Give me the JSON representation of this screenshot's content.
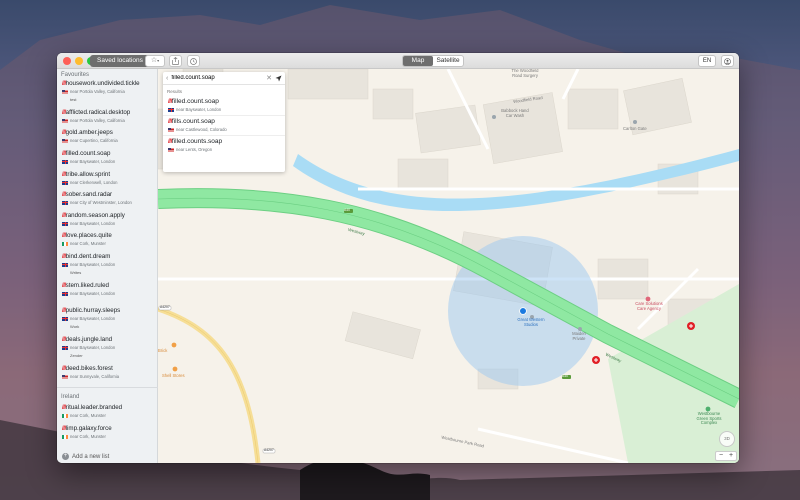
{
  "toolbar": {
    "saved_locations_label": "Saved locations",
    "view_modes": [
      {
        "label": "Map",
        "active": true
      },
      {
        "label": "Satellite",
        "active": false
      }
    ],
    "language_label": "EN"
  },
  "sidebar": {
    "sections": [
      {
        "title": "Favourites",
        "items": [
          {
            "address": "housework.undivided.tickle",
            "near": "near Portola Valley, California",
            "flag": "us",
            "note": "test"
          },
          {
            "address": "afflicted.radical.desktop",
            "near": "near Portola Valley, California",
            "flag": "us"
          },
          {
            "address": "gold.amber.jeeps",
            "near": "near Cupertino, California",
            "flag": "us"
          },
          {
            "address": "filled.count.soap",
            "near": "near Bayswater, London",
            "flag": "gb"
          },
          {
            "address": "tribe.allow.sprint",
            "near": "near Clerkenwell, London",
            "flag": "gb"
          },
          {
            "address": "sober.sand.radar",
            "near": "near City of Westminster, London",
            "flag": "gb"
          },
          {
            "address": "random.season.apply",
            "near": "near Bayswater, London",
            "flag": "gb"
          },
          {
            "address": "love.places.quite",
            "near": "near Cork, Munster",
            "flag": "ie"
          },
          {
            "address": "bind.dent.dream",
            "near": "near Bayswater, London",
            "flag": "gb",
            "note": "Writes"
          },
          {
            "address": "stem.liked.ruled",
            "near": "near Bayswater, London",
            "flag": "gb"
          },
          {
            "address": "public.hurray.sleeps",
            "near": "near Bayswater, London",
            "flag": "gb",
            "note": "Work"
          },
          {
            "address": "deals.jungle.land",
            "near": "near Bayswater, London",
            "flag": "gb",
            "note": "Zender"
          },
          {
            "address": "deed.bikes.forest",
            "near": "near Sunnyvale, California",
            "flag": "us"
          }
        ]
      },
      {
        "title": "Ireland",
        "items": [
          {
            "address": "ritual.leader.branded",
            "near": "near Cork, Munster",
            "flag": "ie"
          },
          {
            "address": "limp.galaxy.force",
            "near": "near Cork, Munster",
            "flag": "ie"
          }
        ]
      }
    ],
    "add_list_label": "Add a new list"
  },
  "search": {
    "value": "filled.count.soap",
    "results_label": "Results",
    "results": [
      {
        "address": "filled.count.soap",
        "near": "near Bayswater, London",
        "flag": "gb"
      },
      {
        "address": "fills.count.soap",
        "near": "near Castlewood, Colorado",
        "flag": "us"
      },
      {
        "address": "filled.counts.soap",
        "near": "near Lents, Oregon",
        "flag": "us"
      }
    ]
  },
  "map": {
    "labels": {
      "westway_1": "Westway",
      "westway_2": "Westway",
      "road_a40_1": "A40",
      "road_a40_2": "A40",
      "road_a4207": "A4207",
      "road_a4207_b": "A4207",
      "westbourne_park_road": "Westbourne Park Road",
      "woodfield_road": "Woodfield Road",
      "babbock_car_wash": "Babbock Hand Car Wash",
      "carlton_gate": "Carlton Gate",
      "surgery": "The Woodfield Road Surgery",
      "great_western_studios": "Great Western Studios",
      "maiden_lane": "Maiden Private",
      "care_agency": "Care Solutions Care Agency",
      "westbourne_green": "Westbourne Green Sports Complex",
      "shell": "Shell Stores",
      "brick": "Brick",
      "compass": "3D"
    }
  },
  "colors": {
    "accent_red": "#e11f26",
    "motorway_green": "#8fe8a2",
    "water_blue": "#a9dcf5",
    "location_blue": "#1a7ae0"
  }
}
